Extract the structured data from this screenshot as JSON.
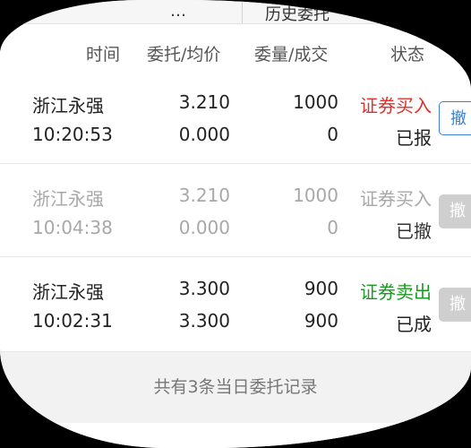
{
  "tabs": {
    "left_label": "…",
    "right_label": "历史委托"
  },
  "header": {
    "time_label": "时间",
    "price_label": "委托/均价",
    "qty_label": "委量/成交",
    "status_label": "状态"
  },
  "orders": [
    {
      "name": "浙江永强",
      "time": "10:20:53",
      "price": "3.210",
      "avg_price": "0.000",
      "qty": "1000",
      "filled": "0",
      "type": "证券买入",
      "state": "已报",
      "cancel": "撤"
    },
    {
      "name": "浙江永强",
      "time": "10:04:38",
      "price": "3.210",
      "avg_price": "0.000",
      "qty": "1000",
      "filled": "0",
      "type": "证券买入",
      "state": "已撤",
      "cancel": "撤"
    },
    {
      "name": "浙江永强",
      "time": "10:02:31",
      "price": "3.300",
      "avg_price": "3.300",
      "qty": "900",
      "filled": "900",
      "type": "证券卖出",
      "state": "已成",
      "cancel": "撤"
    }
  ],
  "footer": {
    "summary": "共有3条当日委托记录"
  },
  "colors": {
    "buy": "#e0312d",
    "sell": "#1a9a20",
    "inactive": "#a8a8a8",
    "button_blue": "#3d7fd0"
  }
}
